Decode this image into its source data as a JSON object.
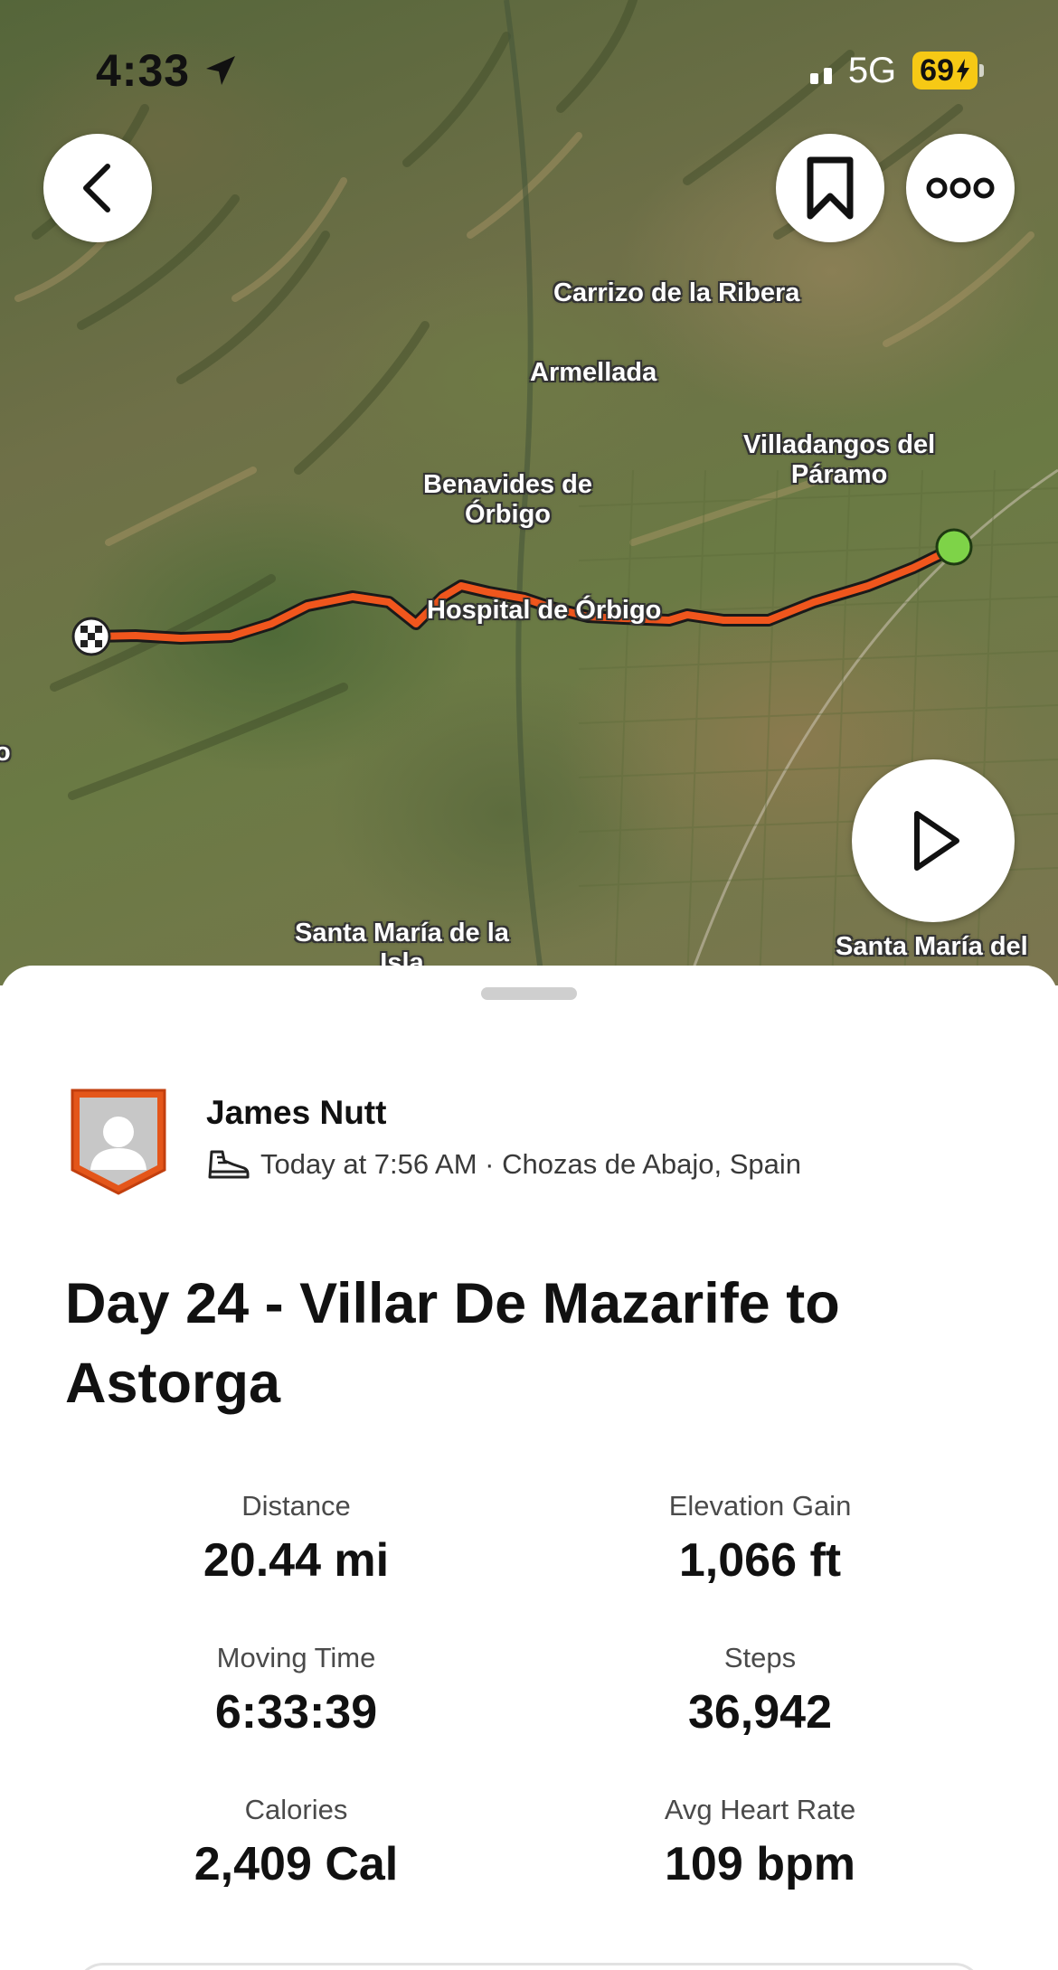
{
  "status_bar": {
    "time": "4:33",
    "network": "5G",
    "battery": "69"
  },
  "map": {
    "labels": {
      "carrizo": "Carrizo de la Ribera",
      "armellada": "Armellada",
      "villadangos_1": "Villadangos del",
      "villadangos_2": "Páramo",
      "benavides_1": "Benavides de",
      "benavides_2": "Órbigo",
      "hospital": "Hospital de Órbigo",
      "santa_maria_isla": "Santa María de la",
      "santa_maria_isla_2": "Isla",
      "santa_maria_del": "Santa María del",
      "edge_o": "o"
    },
    "route_color": "#f0561d",
    "start_marker_color": "#7ed348",
    "icons": {
      "back": "chevron-left-icon",
      "bookmark": "bookmark-icon",
      "more": "more-icon",
      "play": "play-icon"
    }
  },
  "activity": {
    "athlete_name": "James Nutt",
    "meta": "Today at 7:56 AM · Chozas de Abajo, Spain",
    "title": "Day 24 - Villar De Mazarife to Astorga",
    "stats": [
      {
        "label": "Distance",
        "value": "20.44 mi"
      },
      {
        "label": "Elevation Gain",
        "value": "1,066 ft"
      },
      {
        "label": "Moving Time",
        "value": "6:33:39"
      },
      {
        "label": "Steps",
        "value": "36,942"
      },
      {
        "label": "Calories",
        "value": "2,409 Cal"
      },
      {
        "label": "Avg Heart Rate",
        "value": "109 bpm"
      }
    ]
  },
  "colors": {
    "accent_orange": "#fc4c02",
    "battery_yellow": "#f6c915"
  }
}
